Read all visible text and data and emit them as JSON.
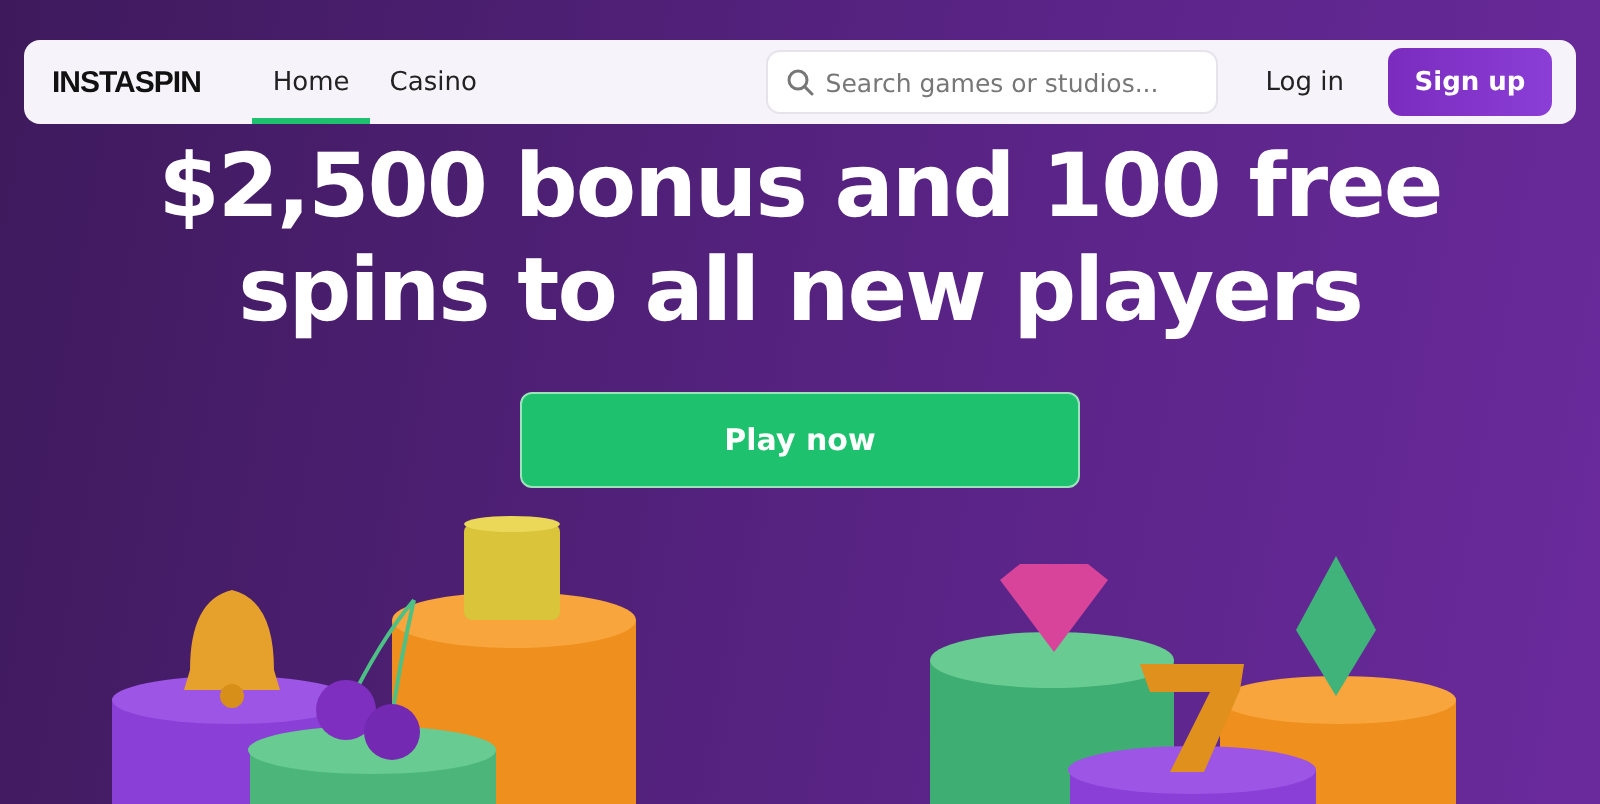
{
  "header": {
    "logo": "INSTASPIN",
    "nav": [
      {
        "label": "Home",
        "selected": true
      },
      {
        "label": "Casino",
        "selected": false
      }
    ],
    "search": {
      "placeholder": "Search games or studios..."
    },
    "login": "Log in",
    "signup": "Sign up"
  },
  "hero": {
    "headline": "$2,500 bonus and 100 free spins to all new players",
    "cta": "Play now"
  }
}
